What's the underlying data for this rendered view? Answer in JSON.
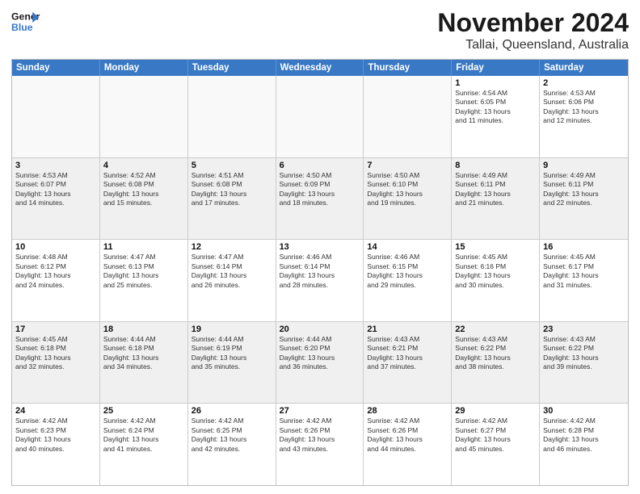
{
  "header": {
    "logo_general": "General",
    "logo_blue": "Blue",
    "month": "November 2024",
    "location": "Tallai, Queensland, Australia"
  },
  "weekdays": [
    "Sunday",
    "Monday",
    "Tuesday",
    "Wednesday",
    "Thursday",
    "Friday",
    "Saturday"
  ],
  "rows": [
    [
      {
        "day": "",
        "info": "",
        "empty": true
      },
      {
        "day": "",
        "info": "",
        "empty": true
      },
      {
        "day": "",
        "info": "",
        "empty": true
      },
      {
        "day": "",
        "info": "",
        "empty": true
      },
      {
        "day": "",
        "info": "",
        "empty": true
      },
      {
        "day": "1",
        "info": "Sunrise: 4:54 AM\nSunset: 6:05 PM\nDaylight: 13 hours\nand 11 minutes."
      },
      {
        "day": "2",
        "info": "Sunrise: 4:53 AM\nSunset: 6:06 PM\nDaylight: 13 hours\nand 12 minutes."
      }
    ],
    [
      {
        "day": "3",
        "info": "Sunrise: 4:53 AM\nSunset: 6:07 PM\nDaylight: 13 hours\nand 14 minutes."
      },
      {
        "day": "4",
        "info": "Sunrise: 4:52 AM\nSunset: 6:08 PM\nDaylight: 13 hours\nand 15 minutes."
      },
      {
        "day": "5",
        "info": "Sunrise: 4:51 AM\nSunset: 6:08 PM\nDaylight: 13 hours\nand 17 minutes."
      },
      {
        "day": "6",
        "info": "Sunrise: 4:50 AM\nSunset: 6:09 PM\nDaylight: 13 hours\nand 18 minutes."
      },
      {
        "day": "7",
        "info": "Sunrise: 4:50 AM\nSunset: 6:10 PM\nDaylight: 13 hours\nand 19 minutes."
      },
      {
        "day": "8",
        "info": "Sunrise: 4:49 AM\nSunset: 6:11 PM\nDaylight: 13 hours\nand 21 minutes."
      },
      {
        "day": "9",
        "info": "Sunrise: 4:49 AM\nSunset: 6:11 PM\nDaylight: 13 hours\nand 22 minutes."
      }
    ],
    [
      {
        "day": "10",
        "info": "Sunrise: 4:48 AM\nSunset: 6:12 PM\nDaylight: 13 hours\nand 24 minutes."
      },
      {
        "day": "11",
        "info": "Sunrise: 4:47 AM\nSunset: 6:13 PM\nDaylight: 13 hours\nand 25 minutes."
      },
      {
        "day": "12",
        "info": "Sunrise: 4:47 AM\nSunset: 6:14 PM\nDaylight: 13 hours\nand 26 minutes."
      },
      {
        "day": "13",
        "info": "Sunrise: 4:46 AM\nSunset: 6:14 PM\nDaylight: 13 hours\nand 28 minutes."
      },
      {
        "day": "14",
        "info": "Sunrise: 4:46 AM\nSunset: 6:15 PM\nDaylight: 13 hours\nand 29 minutes."
      },
      {
        "day": "15",
        "info": "Sunrise: 4:45 AM\nSunset: 6:16 PM\nDaylight: 13 hours\nand 30 minutes."
      },
      {
        "day": "16",
        "info": "Sunrise: 4:45 AM\nSunset: 6:17 PM\nDaylight: 13 hours\nand 31 minutes."
      }
    ],
    [
      {
        "day": "17",
        "info": "Sunrise: 4:45 AM\nSunset: 6:18 PM\nDaylight: 13 hours\nand 32 minutes."
      },
      {
        "day": "18",
        "info": "Sunrise: 4:44 AM\nSunset: 6:18 PM\nDaylight: 13 hours\nand 34 minutes."
      },
      {
        "day": "19",
        "info": "Sunrise: 4:44 AM\nSunset: 6:19 PM\nDaylight: 13 hours\nand 35 minutes."
      },
      {
        "day": "20",
        "info": "Sunrise: 4:44 AM\nSunset: 6:20 PM\nDaylight: 13 hours\nand 36 minutes."
      },
      {
        "day": "21",
        "info": "Sunrise: 4:43 AM\nSunset: 6:21 PM\nDaylight: 13 hours\nand 37 minutes."
      },
      {
        "day": "22",
        "info": "Sunrise: 4:43 AM\nSunset: 6:22 PM\nDaylight: 13 hours\nand 38 minutes."
      },
      {
        "day": "23",
        "info": "Sunrise: 4:43 AM\nSunset: 6:22 PM\nDaylight: 13 hours\nand 39 minutes."
      }
    ],
    [
      {
        "day": "24",
        "info": "Sunrise: 4:42 AM\nSunset: 6:23 PM\nDaylight: 13 hours\nand 40 minutes."
      },
      {
        "day": "25",
        "info": "Sunrise: 4:42 AM\nSunset: 6:24 PM\nDaylight: 13 hours\nand 41 minutes."
      },
      {
        "day": "26",
        "info": "Sunrise: 4:42 AM\nSunset: 6:25 PM\nDaylight: 13 hours\nand 42 minutes."
      },
      {
        "day": "27",
        "info": "Sunrise: 4:42 AM\nSunset: 6:26 PM\nDaylight: 13 hours\nand 43 minutes."
      },
      {
        "day": "28",
        "info": "Sunrise: 4:42 AM\nSunset: 6:26 PM\nDaylight: 13 hours\nand 44 minutes."
      },
      {
        "day": "29",
        "info": "Sunrise: 4:42 AM\nSunset: 6:27 PM\nDaylight: 13 hours\nand 45 minutes."
      },
      {
        "day": "30",
        "info": "Sunrise: 4:42 AM\nSunset: 6:28 PM\nDaylight: 13 hours\nand 46 minutes."
      }
    ]
  ]
}
